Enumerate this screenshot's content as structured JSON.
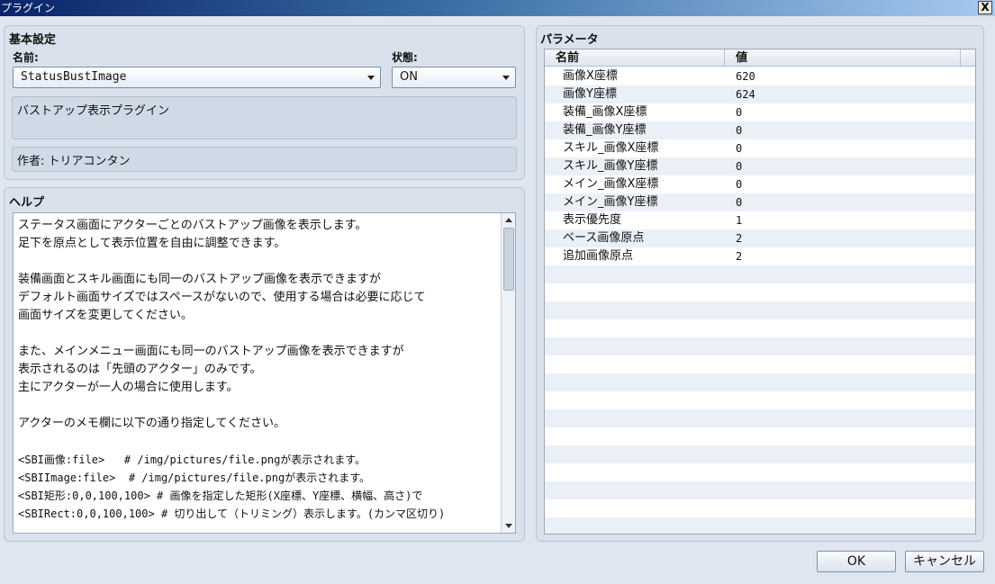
{
  "window": {
    "title": "プラグイン",
    "close_label": "X"
  },
  "basic": {
    "section_title": "基本設定",
    "name_label": "名前:",
    "name_value": "StatusBustImage",
    "state_label": "状態:",
    "state_value": "ON",
    "description": "バストアップ表示プラグイン",
    "author": "作者: トリアコンタン"
  },
  "help": {
    "section_title": "ヘルプ",
    "lines": [
      "ステータス画面にアクターごとのバストアップ画像を表示します。",
      "足下を原点として表示位置を自由に調整できます。",
      "",
      "装備画面とスキル画面にも同一のバストアップ画像を表示できますが",
      "デフォルト画面サイズではスペースがないので、使用する場合は必要に応じて",
      "画面サイズを変更してください。",
      "",
      "また、メインメニュー画面にも同一のバストアップ画像を表示できますが",
      "表示されるのは「先頭のアクター」のみです。",
      "主にアクターが一人の場合に使用します。",
      "",
      "アクターのメモ欄に以下の通り指定してください。",
      "",
      "<SBI画像:file>   # /img/pictures/file.pngが表示されます。",
      "<SBIImage:file>  # /img/pictures/file.pngが表示されます。",
      "<SBI矩形:0,0,100,100> # 画像を指定した矩形(X座標、Y座標、横幅、高さ)で",
      "<SBIRect:0,0,100,100> # 切り出して（トリミング）表示します。(カンマ区切り)"
    ]
  },
  "params": {
    "section_title": "パラメータ",
    "columns": [
      "名前",
      "値"
    ],
    "rows": [
      {
        "name": "画像X座標",
        "value": "620"
      },
      {
        "name": "画像Y座標",
        "value": "624"
      },
      {
        "name": "装備_画像X座標",
        "value": "0"
      },
      {
        "name": "装備_画像Y座標",
        "value": "0"
      },
      {
        "name": "スキル_画像X座標",
        "value": "0"
      },
      {
        "name": "スキル_画像Y座標",
        "value": "0"
      },
      {
        "name": "メイン_画像X座標",
        "value": "0"
      },
      {
        "name": "メイン_画像Y座標",
        "value": "0"
      },
      {
        "name": "表示優先度",
        "value": "1"
      },
      {
        "name": "ベース画像原点",
        "value": "2"
      },
      {
        "name": "追加画像原点",
        "value": "2"
      }
    ]
  },
  "buttons": {
    "ok": "OK",
    "cancel": "キャンセル"
  }
}
